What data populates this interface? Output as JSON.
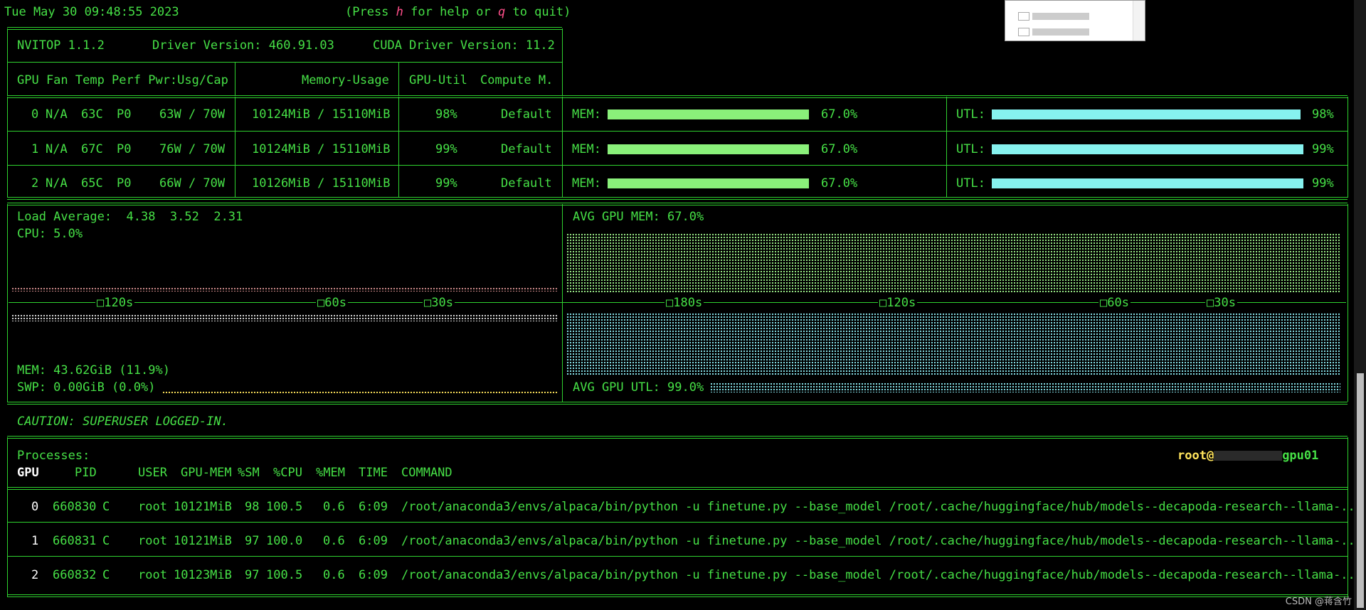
{
  "header": {
    "datetime": "Tue May 30 09:48:55 2023",
    "help_prefix": "(Press ",
    "help_key": "h",
    "help_mid": " for help or ",
    "quit_key": "q",
    "help_suffix": " to quit)"
  },
  "info": {
    "version": "NVITOP 1.1.2",
    "driver": "Driver Version: 460.91.03",
    "cuda": "CUDA Driver Version: 11.2"
  },
  "gpu_table": {
    "headers": {
      "left": "GPU Fan Temp Perf Pwr:Usg/Cap",
      "memory": "Memory-Usage",
      "util": "GPU-Util",
      "compute": "Compute M."
    },
    "rows": [
      {
        "gpu": "0",
        "fan": "N/A",
        "temp": "63C",
        "perf": "P0",
        "pwr": "63W / 70W",
        "mem": "10124MiB / 15110MiB",
        "util": "98%",
        "compute": "Default",
        "mem_label": "MEM:",
        "mem_pct_text": "67.0%",
        "mem_frac": 0.67,
        "utl_label": "UTL:",
        "utl_pct_text": "98%",
        "utl_frac": 0.98
      },
      {
        "gpu": "1",
        "fan": "N/A",
        "temp": "67C",
        "perf": "P0",
        "pwr": "76W / 70W",
        "mem": "10124MiB / 15110MiB",
        "util": "99%",
        "compute": "Default",
        "mem_label": "MEM:",
        "mem_pct_text": "67.0%",
        "mem_frac": 0.67,
        "utl_label": "UTL:",
        "utl_pct_text": "99%",
        "utl_frac": 0.99
      },
      {
        "gpu": "2",
        "fan": "N/A",
        "temp": "65C",
        "perf": "P0",
        "pwr": "66W / 70W",
        "mem": "10126MiB / 15110MiB",
        "util": "99%",
        "compute": "Default",
        "mem_label": "MEM:",
        "mem_pct_text": "67.0%",
        "mem_frac": 0.67,
        "utl_label": "UTL:",
        "utl_pct_text": "99%",
        "utl_frac": 0.99
      }
    ]
  },
  "host_panel": {
    "load_average": "Load Average:  4.38  3.52  2.31",
    "cpu": "CPU: 5.0%",
    "mem": "MEM: 43.62GiB (11.9%)",
    "swp": "SWP: 0.00GiB (0.0%)",
    "ticks": [
      "□120s",
      "□60s",
      "□30s"
    ]
  },
  "gpu_panel": {
    "avg_mem": "AVG GPU MEM: 67.0%",
    "avg_utl": "AVG GPU UTL: 99.0%",
    "ticks": [
      "□180s",
      "□120s",
      "□60s",
      "□30s"
    ]
  },
  "caution": "CAUTION: SUPERUSER LOGGED-IN.",
  "processes": {
    "title": "Processes:",
    "user_host_prefix": "root@",
    "user_host_suffix": "gpu01",
    "headers": {
      "gpu": "GPU",
      "pid": "PID",
      "user": "USER",
      "gpu_mem": "GPU-MEM",
      "sm": "%SM",
      "cpu": "%CPU",
      "mem": "%MEM",
      "time": "TIME",
      "command": "COMMAND"
    },
    "rows": [
      {
        "gpu": "0",
        "pid": "660830",
        "type": "C",
        "user": "root",
        "gpu_mem": "10121MiB",
        "sm": "98",
        "cpu": "100.5",
        "mem": "0.6",
        "time": "6:09",
        "command": "/root/anaconda3/envs/alpaca/bin/python -u finetune.py --base_model /root/.cache/huggingface/hub/models--decapoda-research--llama-.."
      },
      {
        "gpu": "1",
        "pid": "660831",
        "type": "C",
        "user": "root",
        "gpu_mem": "10121MiB",
        "sm": "97",
        "cpu": "100.0",
        "mem": "0.6",
        "time": "6:09",
        "command": "/root/anaconda3/envs/alpaca/bin/python -u finetune.py --base_model /root/.cache/huggingface/hub/models--decapoda-research--llama-.."
      },
      {
        "gpu": "2",
        "pid": "660832",
        "type": "C",
        "user": "root",
        "gpu_mem": "10123MiB",
        "sm": "97",
        "cpu": "100.5",
        "mem": "0.6",
        "time": "6:09",
        "command": "/root/anaconda3/envs/alpaca/bin/python -u finetune.py --base_model /root/.cache/huggingface/hub/models--decapoda-research--llama-.."
      }
    ]
  },
  "watermark": "CSDN @蒋含竹",
  "colors": {
    "green": "#46e046",
    "mem_bar": "#8af07a",
    "utl_bar": "#86f2ef",
    "warning_yellow": "#ffe45c",
    "key_pink": "#ff4f8a"
  }
}
